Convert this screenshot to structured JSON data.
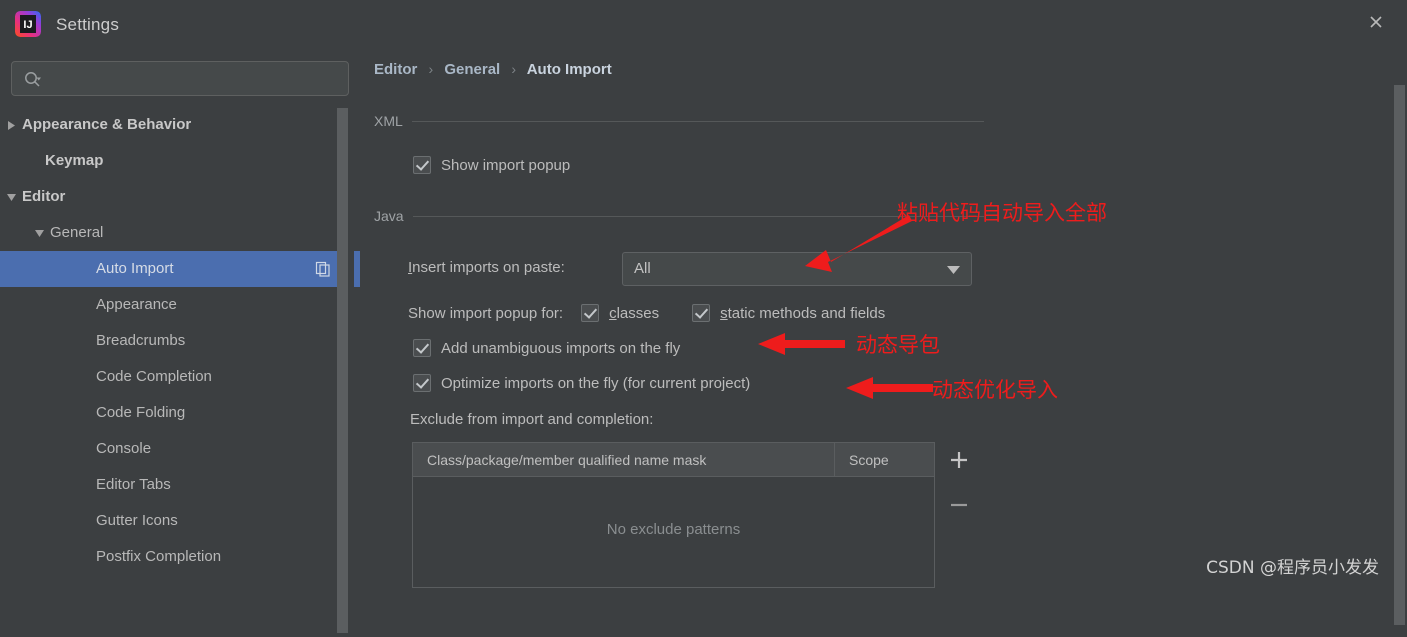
{
  "window": {
    "title": "Settings",
    "app_icon": "intellij-idea-logo",
    "close_icon": "close-icon"
  },
  "sidebar": {
    "search": {
      "placeholder": "",
      "value": "",
      "icon": "search-icon"
    },
    "items": [
      {
        "label": "Appearance & Behavior",
        "indent": 22,
        "twisty": "collapsed",
        "bold": true,
        "selected": false
      },
      {
        "label": "Keymap",
        "indent": 45,
        "twisty": "none",
        "bold": true,
        "selected": false
      },
      {
        "label": "Editor",
        "indent": 22,
        "twisty": "expanded",
        "bold": true,
        "selected": false
      },
      {
        "label": "General",
        "indent": 50,
        "twisty": "expanded",
        "bold": false,
        "selected": false
      },
      {
        "label": "Auto Import",
        "indent": 96,
        "twisty": "none",
        "bold": false,
        "selected": true,
        "badge": "copy-icon"
      },
      {
        "label": "Appearance",
        "indent": 96,
        "twisty": "none",
        "bold": false,
        "selected": false
      },
      {
        "label": "Breadcrumbs",
        "indent": 96,
        "twisty": "none",
        "bold": false,
        "selected": false
      },
      {
        "label": "Code Completion",
        "indent": 96,
        "twisty": "none",
        "bold": false,
        "selected": false
      },
      {
        "label": "Code Folding",
        "indent": 96,
        "twisty": "none",
        "bold": false,
        "selected": false
      },
      {
        "label": "Console",
        "indent": 96,
        "twisty": "none",
        "bold": false,
        "selected": false
      },
      {
        "label": "Editor Tabs",
        "indent": 96,
        "twisty": "none",
        "bold": false,
        "selected": false
      },
      {
        "label": "Gutter Icons",
        "indent": 96,
        "twisty": "none",
        "bold": false,
        "selected": false
      },
      {
        "label": "Postfix Completion",
        "indent": 96,
        "twisty": "none",
        "bold": false,
        "selected": false
      }
    ]
  },
  "main": {
    "breadcrumb": {
      "root": "Editor",
      "middle": "General",
      "current": "Auto Import",
      "separator": "›"
    },
    "xml_group": {
      "title": "XML",
      "show_import_popup": {
        "label": "Show import popup",
        "checked": true
      }
    },
    "java_group": {
      "title": "Java",
      "insert_imports_label": "Insert imports on paste:",
      "insert_imports_value": "All",
      "show_import_popup_for_label": "Show import popup for:",
      "classes": {
        "label": "classes",
        "checked": true
      },
      "static_methods": {
        "label": "static methods and fields",
        "checked": true
      },
      "add_unambiguous": {
        "label": "Add unambiguous imports on the fly",
        "checked": true
      },
      "optimize_imports": {
        "label": "Optimize imports on the fly (for current project)",
        "checked": true
      },
      "exclude_label": "Exclude from import and completion:"
    },
    "exclude_table": {
      "columns": [
        "Class/package/member qualified name mask",
        "Scope"
      ],
      "rows": [],
      "empty_text": "No exclude patterns",
      "add_button": "+",
      "remove_button": "−"
    }
  },
  "annotations": [
    {
      "text": "粘贴代码自动导入全部",
      "color": "#ee1c1c"
    },
    {
      "text": "动态导包",
      "color": "#ee1c1c"
    },
    {
      "text": "动态优化导入",
      "color": "#ee1c1c"
    }
  ],
  "watermark": {
    "text": "CSDN @程序员小发发"
  },
  "colors": {
    "window_bg": "#3c3f41",
    "selection_blue": "#4b6eaf",
    "annotation_red": "#ee1c1c",
    "text": "#bbbbbb",
    "breadcrumb_text": "#a9b7c6"
  }
}
